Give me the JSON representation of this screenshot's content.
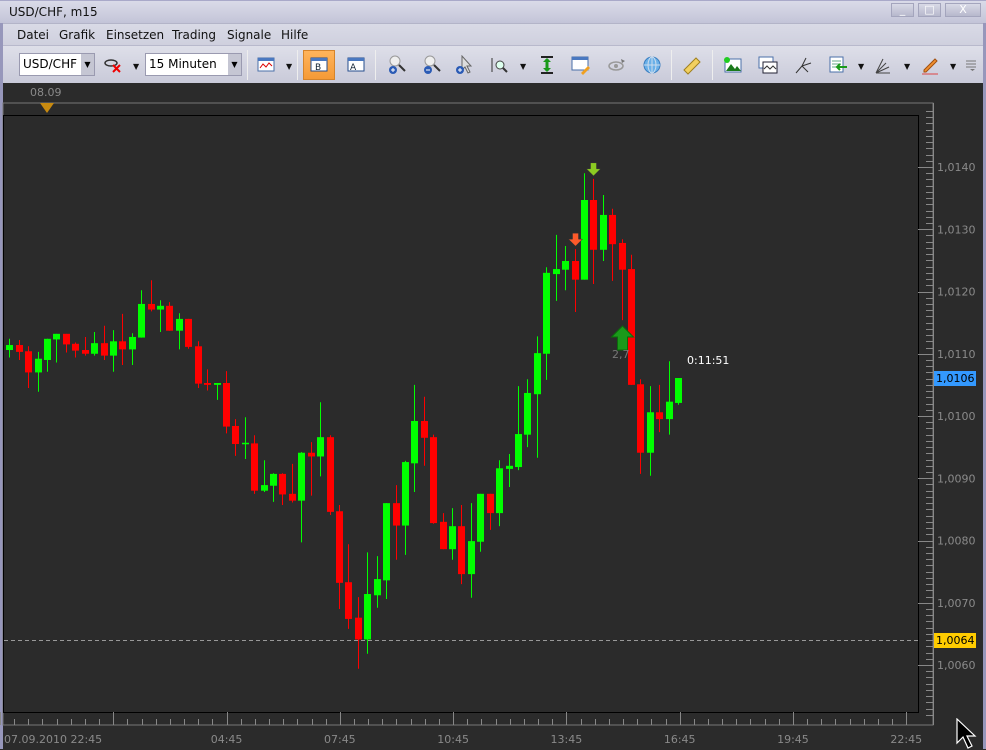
{
  "window": {
    "title": "USD/CHF, m15",
    "minimize_label": "_",
    "maximize_label": "□",
    "close_label": "X"
  },
  "menu": [
    "Datei",
    "Grafik",
    "Einsetzen",
    "Trading",
    "Signale",
    "Hilfe"
  ],
  "toolbar": {
    "symbol": "USD/CHF",
    "timeframe": "15 Minuten",
    "icons": [
      "remove-indicator-icon",
      "chart-type-icon",
      "bar-chart-mode-icon",
      "text-mode-icon",
      "zoom-in-icon",
      "zoom-out-icon",
      "cursor-plus-icon",
      "zoom-range-icon",
      "vertical-fit-icon",
      "edit-window-icon",
      "eye-icon",
      "globe-icon",
      "ruler-icon",
      "add-image-icon",
      "chart-window-icon",
      "pitchfork-icon",
      "list-arrow-icon",
      "fan-icon",
      "pencil-icon",
      "overflow-menu-icon"
    ]
  },
  "top_strip": {
    "date_marker": "08.09"
  },
  "chart_data": {
    "type": "candlestick",
    "symbol": "USD/CHF",
    "timeframe": "m15",
    "colors": {
      "up": "#00ff00",
      "down": "#ff0000",
      "background": "#2b2b2b"
    },
    "ylim": [
      1.0052,
      1.0149
    ],
    "y_ticks": [
      {
        "value": 1.014,
        "label": "1,0140"
      },
      {
        "value": 1.013,
        "label": "1,0130"
      },
      {
        "value": 1.012,
        "label": "1,0120"
      },
      {
        "value": 1.011,
        "label": "1,0110"
      },
      {
        "value": 1.01,
        "label": "1,0100"
      },
      {
        "value": 1.009,
        "label": "1,0090"
      },
      {
        "value": 1.008,
        "label": "1,0080"
      },
      {
        "value": 1.007,
        "label": "1,0070"
      },
      {
        "value": 1.006,
        "label": "1,0060"
      }
    ],
    "x_ticks": [
      {
        "time": "2010-09-07 22:45",
        "label": "07.09.2010 22:45"
      },
      {
        "time": "2010-09-08 04:45",
        "label": "04:45"
      },
      {
        "time": "2010-09-08 07:45",
        "label": "07:45"
      },
      {
        "time": "2010-09-08 10:45",
        "label": "10:45"
      },
      {
        "time": "2010-09-08 13:45",
        "label": "13:45"
      },
      {
        "time": "2010-09-08 16:45",
        "label": "16:45"
      },
      {
        "time": "2010-09-08 19:45",
        "label": "19:45"
      },
      {
        "time": "2010-09-08 22:45",
        "label": "22:45"
      }
    ],
    "columns": [
      "time",
      "open",
      "high",
      "low",
      "close"
    ],
    "candles": [
      [
        "23:00",
        1.01106,
        1.01124,
        1.01094,
        1.01114
      ],
      [
        "23:15",
        1.01114,
        1.01122,
        1.0109,
        1.01103
      ],
      [
        "23:30",
        1.01104,
        1.01112,
        1.01045,
        1.0107
      ],
      [
        "23:45",
        1.0107,
        1.01103,
        1.01039,
        1.01092
      ],
      [
        "00:00",
        1.0109,
        1.01124,
        1.01071,
        1.01124
      ],
      [
        "00:15",
        1.01123,
        1.01132,
        1.01086,
        1.01132
      ],
      [
        "00:30",
        1.01132,
        1.01132,
        1.01102,
        1.01115
      ],
      [
        "00:45",
        1.01116,
        1.01118,
        1.01094,
        1.01105
      ],
      [
        "01:00",
        1.01106,
        1.01127,
        1.01097,
        1.011
      ],
      [
        "01:15",
        1.011,
        1.01135,
        1.01097,
        1.01117
      ],
      [
        "01:30",
        1.01117,
        1.01145,
        1.0109,
        1.01097
      ],
      [
        "01:45",
        1.01097,
        1.01138,
        1.01071,
        1.0112
      ],
      [
        "02:00",
        1.0112,
        1.01164,
        1.01082,
        1.01107
      ],
      [
        "02:15",
        1.01107,
        1.01133,
        1.01082,
        1.01127
      ],
      [
        "02:30",
        1.01126,
        1.01202,
        1.01126,
        1.0118
      ],
      [
        "02:45",
        1.0118,
        1.01218,
        1.01168,
        1.01171
      ],
      [
        "03:00",
        1.01171,
        1.01186,
        1.01135,
        1.01177
      ],
      [
        "03:15",
        1.01177,
        1.01183,
        1.01137,
        1.01137
      ],
      [
        "03:30",
        1.01137,
        1.01165,
        1.01107,
        1.01156
      ],
      [
        "03:45",
        1.01156,
        1.01156,
        1.01108,
        1.01111
      ],
      [
        "04:00",
        1.01112,
        1.0112,
        1.01045,
        1.01052
      ],
      [
        "04:15",
        1.01053,
        1.01075,
        1.01041,
        1.0105
      ],
      [
        "04:30",
        1.0105,
        1.01053,
        1.01026,
        1.01053
      ],
      [
        "04:45",
        1.01053,
        1.01072,
        1.00972,
        1.00983
      ],
      [
        "05:00",
        1.00984,
        1.00995,
        1.00936,
        1.00955
      ],
      [
        "05:15",
        1.00955,
        1.00998,
        1.00931,
        1.00957
      ],
      [
        "05:30",
        1.00956,
        1.00969,
        1.00875,
        1.0088
      ],
      [
        "05:45",
        1.0088,
        1.00929,
        1.00878,
        1.00889
      ],
      [
        "06:00",
        1.00888,
        1.00908,
        1.00862,
        1.00907
      ],
      [
        "06:15",
        1.00907,
        1.00908,
        1.00857,
        1.00874
      ],
      [
        "06:30",
        1.00875,
        1.00923,
        1.00861,
        1.00864
      ],
      [
        "06:45",
        1.00864,
        1.00942,
        1.00797,
        1.00941
      ],
      [
        "07:00",
        1.00941,
        1.00958,
        1.00872,
        1.00935
      ],
      [
        "07:15",
        1.00935,
        1.01022,
        1.00903,
        1.00966
      ],
      [
        "07:30",
        1.00966,
        1.00969,
        1.00841,
        1.00846
      ],
      [
        "07:45",
        1.00847,
        1.00857,
        1.0069,
        1.00732
      ],
      [
        "08:00",
        1.00733,
        1.00794,
        1.00658,
        1.00674
      ],
      [
        "08:15",
        1.00676,
        1.00709,
        1.00594,
        1.00641
      ],
      [
        "08:30",
        1.00641,
        1.00781,
        1.00618,
        1.00714
      ],
      [
        "08:45",
        1.00712,
        1.00775,
        1.00692,
        1.00738
      ],
      [
        "09:00",
        1.00736,
        1.0086,
        1.00706,
        1.0086
      ],
      [
        "09:15",
        1.0086,
        1.00889,
        1.00769,
        1.00824
      ],
      [
        "09:30",
        1.00824,
        1.00928,
        1.00777,
        1.00926
      ],
      [
        "09:45",
        1.00924,
        1.0105,
        1.00878,
        1.00992
      ],
      [
        "10:00",
        1.00992,
        1.01031,
        1.0092,
        1.00965
      ],
      [
        "10:15",
        1.00966,
        1.0097,
        1.00827,
        1.00828
      ],
      [
        "10:30",
        1.0083,
        1.00844,
        1.00786,
        1.00786
      ],
      [
        "10:45",
        1.00786,
        1.00852,
        1.00769,
        1.00823
      ],
      [
        "11:00",
        1.00823,
        1.00857,
        1.0073,
        1.00746
      ],
      [
        "11:15",
        1.00746,
        1.0086,
        1.00708,
        1.00799
      ],
      [
        "11:30",
        1.00798,
        1.00875,
        1.00782,
        1.00875
      ],
      [
        "11:45",
        1.00875,
        1.00875,
        1.00817,
        1.00844
      ],
      [
        "12:00",
        1.00844,
        1.00929,
        1.00823,
        1.00916
      ],
      [
        "12:15",
        1.00915,
        1.00939,
        1.00886,
        1.0092
      ],
      [
        "12:30",
        1.00918,
        1.01048,
        1.00913,
        1.00971
      ],
      [
        "12:45",
        1.0097,
        1.01059,
        1.0095,
        1.01037
      ],
      [
        "13:00",
        1.01035,
        1.01128,
        1.00933,
        1.01101
      ],
      [
        "13:15",
        1.011,
        1.01239,
        1.01058,
        1.0123
      ],
      [
        "13:30",
        1.01228,
        1.01291,
        1.01185,
        1.01236
      ],
      [
        "13:45",
        1.01235,
        1.01273,
        1.01202,
        1.01249
      ],
      [
        "14:00",
        1.01249,
        1.01268,
        1.01167,
        1.01219
      ],
      [
        "14:15",
        1.01219,
        1.0139,
        1.01219,
        1.01347
      ],
      [
        "14:30",
        1.01347,
        1.01381,
        1.01212,
        1.01267
      ],
      [
        "14:45",
        1.01267,
        1.01355,
        1.01249,
        1.01323
      ],
      [
        "15:00",
        1.01323,
        1.01333,
        1.01217,
        1.01276
      ],
      [
        "15:15",
        1.01278,
        1.01284,
        1.01154,
        1.01235
      ],
      [
        "15:30",
        1.01236,
        1.01259,
        1.0105,
        1.0105
      ],
      [
        "15:45",
        1.01051,
        1.01059,
        1.00907,
        1.00941
      ],
      [
        "16:00",
        1.00941,
        1.01048,
        1.00904,
        1.01006
      ],
      [
        "16:15",
        1.01006,
        1.0105,
        1.00974,
        1.00995
      ],
      [
        "16:30",
        1.00995,
        1.01088,
        1.0097,
        1.01023
      ],
      [
        "16:45",
        1.01021,
        1.01061,
        1.01018,
        1.01061
      ]
    ],
    "signals": [
      {
        "time": "14:00",
        "direction": "down",
        "color": "#ff5a2a"
      },
      {
        "time": "14:30",
        "direction": "down",
        "color": "#8ccc22"
      },
      {
        "time": "15:15",
        "direction": "up",
        "color": "#1a9a1a",
        "label": "2,7"
      }
    ],
    "bar_timer": "0:11:51",
    "current_price": {
      "value": 1.0106,
      "label": "1,0106",
      "color": "#3399ff"
    },
    "alert_line": {
      "value": 1.0064,
      "label": "1,0064",
      "color": "#ffcc00"
    }
  }
}
